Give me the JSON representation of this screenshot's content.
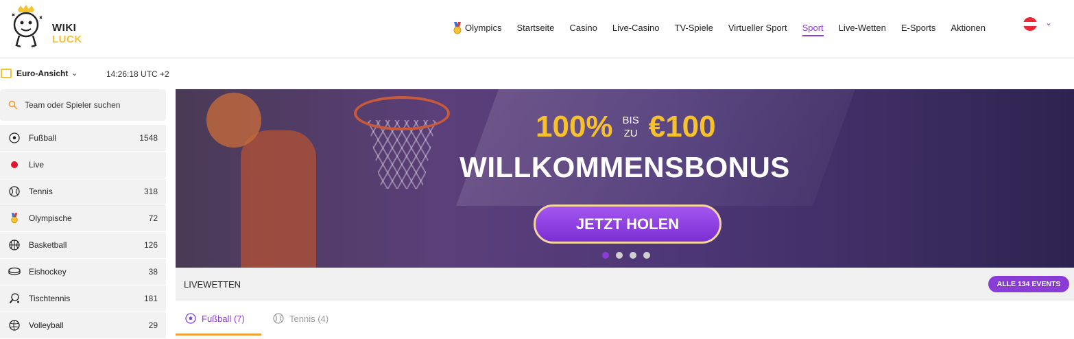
{
  "header": {
    "logo": {
      "line1": "WIKI",
      "line2": "LUCK"
    },
    "nav": [
      {
        "label": "Olympics",
        "icon": "medal-icon"
      },
      {
        "label": "Startseite"
      },
      {
        "label": "Casino"
      },
      {
        "label": "Live-Casino"
      },
      {
        "label": "TV-Spiele"
      },
      {
        "label": "Virtueller Sport"
      },
      {
        "label": "Sport",
        "active": true
      },
      {
        "label": "Live-Wetten"
      },
      {
        "label": "E-Sports"
      },
      {
        "label": "Aktionen"
      }
    ],
    "language_flag": "austria-flag-icon",
    "colors": {
      "accent": "#8a3cd6",
      "brand_yellow": "#f4c430"
    }
  },
  "subbar": {
    "view_label": "Euro-Ansicht",
    "time": "14:26:18 UTC +2"
  },
  "sidebar": {
    "search_placeholder": "Team oder Spieler suchen",
    "sports": [
      {
        "name": "Fußball",
        "count": "1548",
        "icon": "soccer-ball-icon"
      },
      {
        "name": "Live",
        "count": "",
        "icon": "live-dot-icon"
      },
      {
        "name": "Tennis",
        "count": "318",
        "icon": "tennis-ball-icon"
      },
      {
        "name": "Olympische",
        "count": "72",
        "icon": "medal-icon"
      },
      {
        "name": "Basketball",
        "count": "126",
        "icon": "basketball-icon"
      },
      {
        "name": "Eishockey",
        "count": "38",
        "icon": "hockey-puck-icon"
      },
      {
        "name": "Tischtennis",
        "count": "181",
        "icon": "table-tennis-icon"
      },
      {
        "name": "Volleyball",
        "count": "29",
        "icon": "volleyball-icon"
      }
    ]
  },
  "banner": {
    "percent": "100%",
    "bis": "BIS",
    "zu": "ZU",
    "amount": "€100",
    "headline": "WILLKOMMENSBONUS",
    "cta": "JETZT HOLEN",
    "slides": 4,
    "active_slide": 1
  },
  "live": {
    "title": "LIVEWETTEN",
    "all_events": "ALLE 134 EVENTS",
    "tabs": [
      {
        "label": "Fußball (7)",
        "icon": "soccer-ball-icon",
        "active": true
      },
      {
        "label": "Tennis (4)",
        "icon": "tennis-ball-icon",
        "active": false
      }
    ]
  }
}
